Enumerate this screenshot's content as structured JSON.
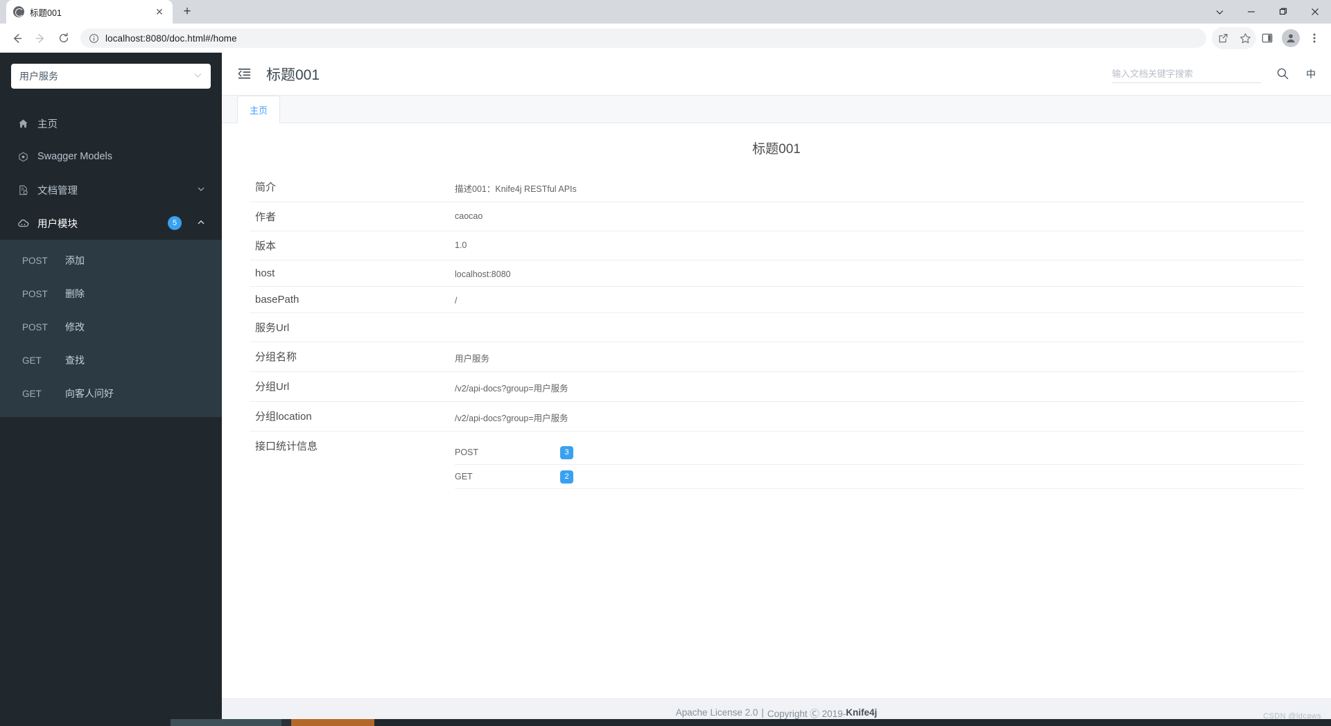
{
  "browser": {
    "tab": {
      "title": "标题001",
      "favicon": "globe-icon",
      "close": "✕"
    },
    "new_tab": "+",
    "window_controls": {
      "more": "chevron-down-icon",
      "minimize": "minimize-icon",
      "maximize": "maximize-icon",
      "close": "close-icon"
    },
    "nav": {
      "back": "back-arrow-icon",
      "forward": "forward-arrow-icon",
      "reload": "reload-icon"
    },
    "omnibox": {
      "info": "info-icon",
      "url": "localhost:8080/doc.html#/home"
    },
    "actions": {
      "share": "share-icon",
      "bookmark": "star-icon",
      "sidepanel": "side-panel-icon",
      "profile": "avatar-icon",
      "menu": "kebab-menu-icon"
    }
  },
  "sidebar": {
    "service_select": {
      "value": "用户服务",
      "chevron": "chevron-down-icon"
    },
    "items": [
      {
        "label": "主页",
        "icon": "home-icon",
        "active": false
      },
      {
        "label": "Swagger Models",
        "icon": "models-icon",
        "active": false
      },
      {
        "label": "文档管理",
        "icon": "document-settings-icon",
        "active": false,
        "arrow": "chevron-down-icon"
      },
      {
        "label": "用户模块",
        "icon": "cloud-api-icon",
        "active": true,
        "badge": "5",
        "arrow": "chevron-up-icon"
      }
    ],
    "submenu": [
      {
        "method": "POST",
        "name": "添加"
      },
      {
        "method": "POST",
        "name": "删除"
      },
      {
        "method": "POST",
        "name": "修改"
      },
      {
        "method": "GET",
        "name": "查找"
      },
      {
        "method": "GET",
        "name": "向客人问好"
      }
    ]
  },
  "header": {
    "collapse_icon": "menu-fold-icon",
    "title": "标题001",
    "search_placeholder": "输入文档关键字搜索",
    "search_value": "",
    "search_icon": "search-icon",
    "lang_button": "中"
  },
  "doc_tabs": [
    {
      "label": "主页",
      "active": true
    }
  ],
  "content": {
    "title": "标题001",
    "rows": [
      {
        "label": "简介",
        "value": "描述001：Knife4j RESTful APIs"
      },
      {
        "label": "作者",
        "value": "caocao"
      },
      {
        "label": "版本",
        "value": "1.0"
      },
      {
        "label": "host",
        "value": "localhost:8080"
      },
      {
        "label": "basePath",
        "value": "/"
      },
      {
        "label": "服务Url",
        "value": ""
      },
      {
        "label": "分组名称",
        "value": "用户服务"
      },
      {
        "label": "分组Url",
        "value": "/v2/api-docs?group=用户服务"
      },
      {
        "label": "分组location",
        "value": "/v2/api-docs?group=用户服务"
      }
    ],
    "stats": {
      "label": "接口统计信息",
      "entries": [
        {
          "method": "POST",
          "count": "3"
        },
        {
          "method": "GET",
          "count": "2"
        }
      ]
    }
  },
  "footer": {
    "license": "Apache License 2.0",
    "separator": "|",
    "copyright": "Copyright Ⓒ 2019-",
    "brand": "Knife4j"
  },
  "watermark": "CSDN @ldcaws",
  "colors": {
    "sidebar_bg": "#20282e",
    "submenu_bg": "#2b3a43",
    "accent": "#3aa1f0",
    "tab_blue": "#409eff"
  }
}
